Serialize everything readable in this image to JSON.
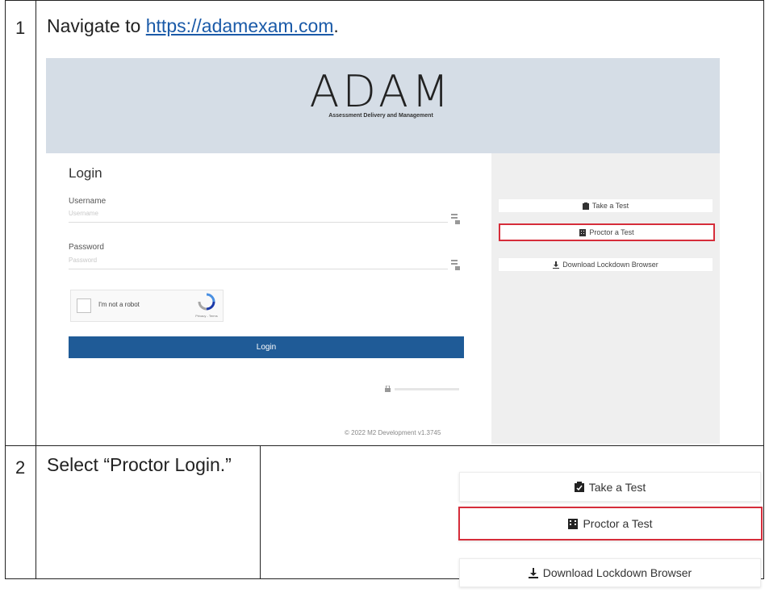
{
  "steps": [
    {
      "number": "1",
      "text_prefix": "Navigate to ",
      "link": "https://adamexam.com",
      "text_suffix": "."
    },
    {
      "number": "2",
      "text": "Select “Proctor Login.”"
    }
  ],
  "site": {
    "logo": "ADAM",
    "logo_subtitle": "Assessment Delivery and Management",
    "login_title": "Login",
    "username_label": "Username",
    "username_placeholder": "Username",
    "password_label": "Password",
    "password_placeholder": "Password",
    "captcha_label": "I'm not a robot",
    "captcha_terms": "Privacy - Terms",
    "login_button": "Login",
    "footer": "© 2022 M2 Development v1.3745",
    "side_buttons": [
      "Take a Test",
      "Proctor a Test",
      "Download Lockdown Browser"
    ]
  },
  "zoom_buttons": [
    "Take a Test",
    "Proctor a Test",
    "Download Lockdown Browser"
  ],
  "colors": {
    "highlight": "#d62d3a",
    "login_button": "#1f5b97",
    "header_bg": "#d5dde6",
    "link": "#1a5aa8"
  }
}
